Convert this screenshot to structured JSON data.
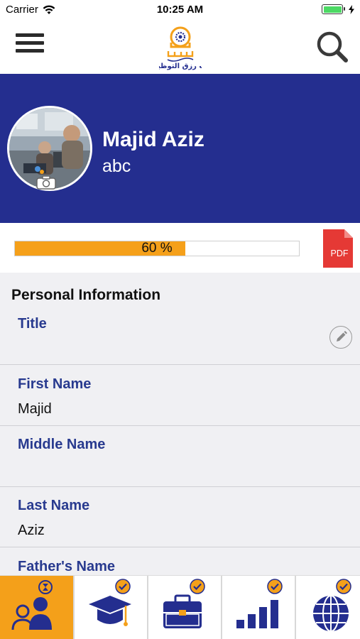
{
  "status_bar": {
    "carrier": "Carrier",
    "time": "10:25 AM"
  },
  "nav": {
    "logo_text": "باب رزق التوظيف",
    "menu_icon": "hamburger-menu-icon",
    "search_icon": "search-icon"
  },
  "profile": {
    "name": "Majid Aziz",
    "subtitle": "abc"
  },
  "progress": {
    "value_percent": 60,
    "label": "60 %",
    "pdf_label": "PDF"
  },
  "section": {
    "title": "Personal Information"
  },
  "fields": [
    {
      "label": "Title",
      "value": ""
    },
    {
      "label": "First Name",
      "value": "Majid"
    },
    {
      "label": "Middle Name",
      "value": ""
    },
    {
      "label": "Last Name",
      "value": "Aziz"
    },
    {
      "label": "Father's Name",
      "value": ""
    }
  ],
  "tabs": [
    {
      "icon": "personal-info-icon",
      "active": true,
      "completed": false
    },
    {
      "icon": "education-icon",
      "active": false,
      "completed": true
    },
    {
      "icon": "experience-icon",
      "active": false,
      "completed": true
    },
    {
      "icon": "skills-icon",
      "active": false,
      "completed": true
    },
    {
      "icon": "languages-icon",
      "active": false,
      "completed": true
    }
  ],
  "colors": {
    "header_blue": "#242e8f",
    "accent_orange": "#f4a01a",
    "label_blue": "#283a8f",
    "pdf_red": "#e53935"
  }
}
